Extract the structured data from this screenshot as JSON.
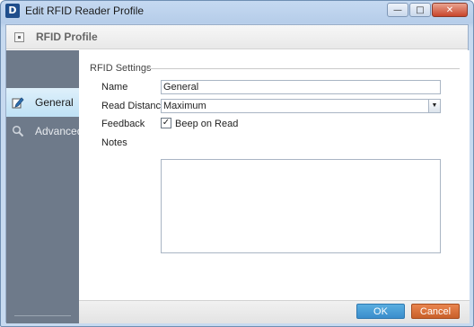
{
  "window": {
    "logo": "D",
    "title": "Edit RFID Reader Profile",
    "controls": {
      "minimize": "—",
      "maximize": "□",
      "close": "✕"
    }
  },
  "header": {
    "title": "RFID Profile"
  },
  "sidebar": {
    "items": [
      {
        "label": "General",
        "icon": "edit-icon",
        "active": true
      },
      {
        "label": "Advanced",
        "icon": "magnifier-icon",
        "active": false
      }
    ]
  },
  "settings": {
    "group_title": "RFID Settings",
    "name_label": "Name",
    "name_value": "General",
    "read_distance_label": "Read Distance",
    "read_distance_value": "Maximum",
    "feedback_label": "Feedback",
    "feedback_checkbox_label": "Beep on Read",
    "feedback_checked": true,
    "notes_label": "Notes",
    "notes_value": ""
  },
  "buttons": {
    "ok": "OK",
    "cancel": "Cancel"
  },
  "colors": {
    "sidebar_bg": "#6e7a8a",
    "active_item": "#bfe1f5",
    "ok_button": "#3a8dcc",
    "cancel_button": "#c95f29"
  }
}
